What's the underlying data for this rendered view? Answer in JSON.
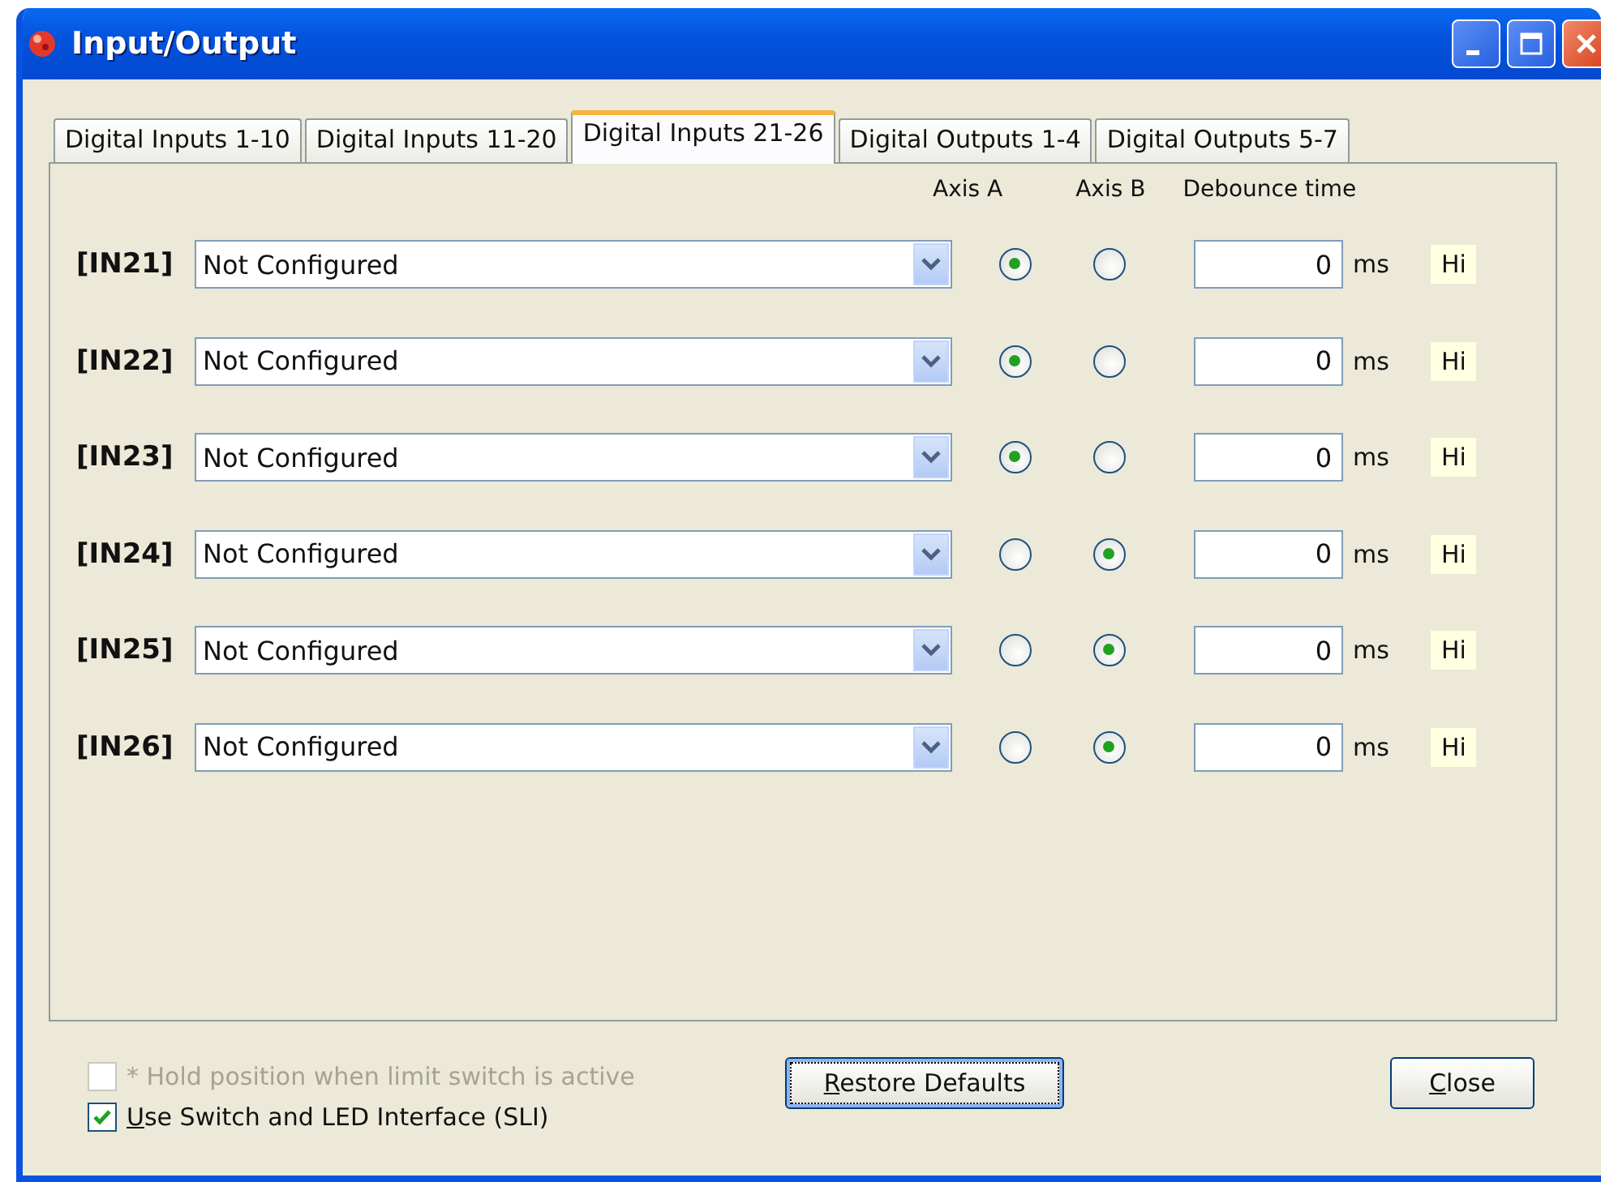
{
  "window": {
    "title": "Input/Output"
  },
  "tabs": [
    {
      "label": "Digital Inputs 1-10",
      "selected": false
    },
    {
      "label": "Digital Inputs 11-20",
      "selected": false
    },
    {
      "label": "Digital Inputs 21-26",
      "selected": true
    },
    {
      "label": "Digital Outputs 1-4",
      "selected": false
    },
    {
      "label": "Digital Outputs 5-7",
      "selected": false
    }
  ],
  "columns": {
    "axis_a": "Axis A",
    "axis_b": "Axis B",
    "debounce": "Debounce time"
  },
  "inputs": [
    {
      "label": "[IN21]",
      "function": "Not Configured",
      "axis_a": true,
      "axis_b": false,
      "debounce": "0",
      "unit": "ms",
      "polarity": "Hi"
    },
    {
      "label": "[IN22]",
      "function": "Not Configured",
      "axis_a": true,
      "axis_b": false,
      "debounce": "0",
      "unit": "ms",
      "polarity": "Hi"
    },
    {
      "label": "[IN23]",
      "function": "Not Configured",
      "axis_a": true,
      "axis_b": false,
      "debounce": "0",
      "unit": "ms",
      "polarity": "Hi"
    },
    {
      "label": "[IN24]",
      "function": "Not Configured",
      "axis_a": false,
      "axis_b": true,
      "debounce": "0",
      "unit": "ms",
      "polarity": "Hi"
    },
    {
      "label": "[IN25]",
      "function": "Not Configured",
      "axis_a": false,
      "axis_b": true,
      "debounce": "0",
      "unit": "ms",
      "polarity": "Hi"
    },
    {
      "label": "[IN26]",
      "function": "Not Configured",
      "axis_a": false,
      "axis_b": true,
      "debounce": "0",
      "unit": "ms",
      "polarity": "Hi"
    }
  ],
  "options": [
    {
      "label": "* Hold position when limit switch is active",
      "checked": false,
      "disabled": true
    },
    {
      "label": "Use Switch and LED Interface (SLI)",
      "checked": true,
      "disabled": false
    }
  ],
  "buttons": [
    {
      "label": "Restore Defaults",
      "focused": true
    },
    {
      "label": "Close",
      "focused": false
    }
  ]
}
